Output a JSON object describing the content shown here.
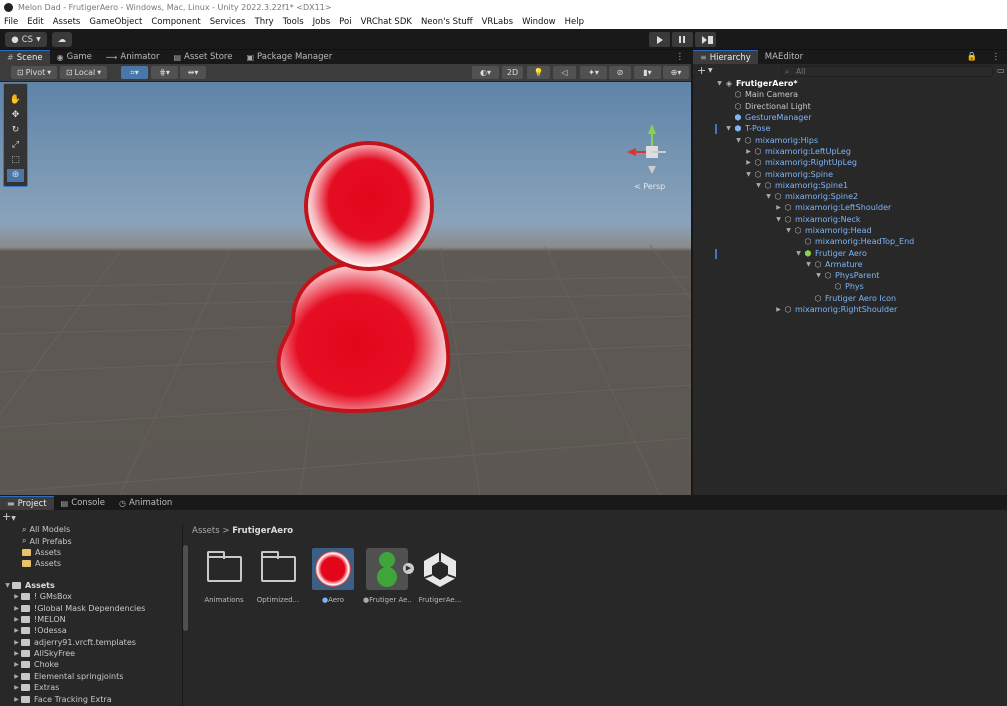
{
  "window": {
    "title": "Melon Dad - FrutigerAero - Windows, Mac, Linux - Unity 2022.3.22f1* <DX11>"
  },
  "menu": [
    "File",
    "Edit",
    "Assets",
    "GameObject",
    "Component",
    "Services",
    "Thry",
    "Tools",
    "Jobs",
    "Poi",
    "VRChat SDK",
    "Neon's Stuff",
    "VRLabs",
    "Window",
    "Help"
  ],
  "toolbar": {
    "account_label": "CS"
  },
  "scene_tabs": [
    {
      "label": "Scene",
      "icon": "grid-icon",
      "active": true
    },
    {
      "label": "Game",
      "icon": "gamepad-icon",
      "active": false
    },
    {
      "label": "Animator",
      "icon": "animator-icon",
      "active": false
    },
    {
      "label": "Asset Store",
      "icon": "store-icon",
      "active": false
    },
    {
      "label": "Package Manager",
      "icon": "package-icon",
      "active": false
    }
  ],
  "scene_toolbar": {
    "pivot_label": "Pivot",
    "space_label": "Local",
    "mode_2d_label": "2D"
  },
  "scene_view": {
    "persp_label": "< Persp",
    "colors": {
      "icon_red": "#e3061b",
      "icon_border": "#c4121a",
      "sky_top": "#5e84a8",
      "ground": "#5c5752"
    }
  },
  "hierarchy": {
    "tabs": [
      {
        "label": "Hierarchy",
        "active": true
      },
      {
        "label": "MAEditor",
        "active": false
      }
    ],
    "search_placeholder": "All",
    "rows": [
      {
        "label": "FrutigerAero*",
        "type": "scene"
      },
      {
        "label": "Main Camera",
        "type": "normal"
      },
      {
        "label": "Directional Light",
        "type": "normal"
      },
      {
        "label": "GestureManager",
        "type": "prefab"
      },
      {
        "label": "T-Pose",
        "type": "prefab"
      },
      {
        "label": "mixamorig:Hips",
        "type": "prefab"
      },
      {
        "label": "mixamorig:LeftUpLeg",
        "type": "prefab"
      },
      {
        "label": "mixamorig:RightUpLeg",
        "type": "prefab"
      },
      {
        "label": "mixamorig:Spine",
        "type": "prefab"
      },
      {
        "label": "mixamorig:Spine1",
        "type": "prefab"
      },
      {
        "label": "mixamorig:Spine2",
        "type": "prefab"
      },
      {
        "label": "mixamorig:LeftShoulder",
        "type": "prefab"
      },
      {
        "label": "mixamorig:Neck",
        "type": "prefab"
      },
      {
        "label": "mixamorig:Head",
        "type": "prefab"
      },
      {
        "label": "mixamorig:HeadTop_End",
        "type": "prefab"
      },
      {
        "label": "Frutiger Aero",
        "type": "prefab"
      },
      {
        "label": "Armature",
        "type": "prefab"
      },
      {
        "label": "PhysParent",
        "type": "prefab"
      },
      {
        "label": "Phys",
        "type": "prefab"
      },
      {
        "label": "Frutiger Aero Icon",
        "type": "prefab"
      },
      {
        "label": "mixamorig:RightShoulder",
        "type": "prefab"
      }
    ]
  },
  "bottom_tabs": [
    {
      "label": "Project",
      "icon": "folder-icon",
      "active": true
    },
    {
      "label": "Console",
      "icon": "console-icon",
      "active": false
    },
    {
      "label": "Animation",
      "icon": "animation-icon",
      "active": false
    }
  ],
  "project_tree": {
    "favorites": [
      "All Models",
      "All Prefabs",
      "Assets",
      "Assets"
    ],
    "root_label": "Assets",
    "folders": [
      "! GMsBox",
      "!Global Mask Dependencies",
      "!MELON",
      "!Odessa",
      "adjerry91.vrcft.templates",
      "AllSkyFree",
      "Choke",
      "Elemental springjoints",
      "Extras",
      "Face Tracking Extra"
    ]
  },
  "breadcrumb": {
    "root": "Assets",
    "separator": ">",
    "current": "FrutigerAero"
  },
  "assets": [
    {
      "label": "Animations",
      "kind": "folder"
    },
    {
      "label": "Optimized...",
      "kind": "folder"
    },
    {
      "label": "Aero",
      "kind": "material"
    },
    {
      "label": "Frutiger Ae...",
      "kind": "model"
    },
    {
      "label": "FrutigerAe...",
      "kind": "unity-scene"
    }
  ]
}
